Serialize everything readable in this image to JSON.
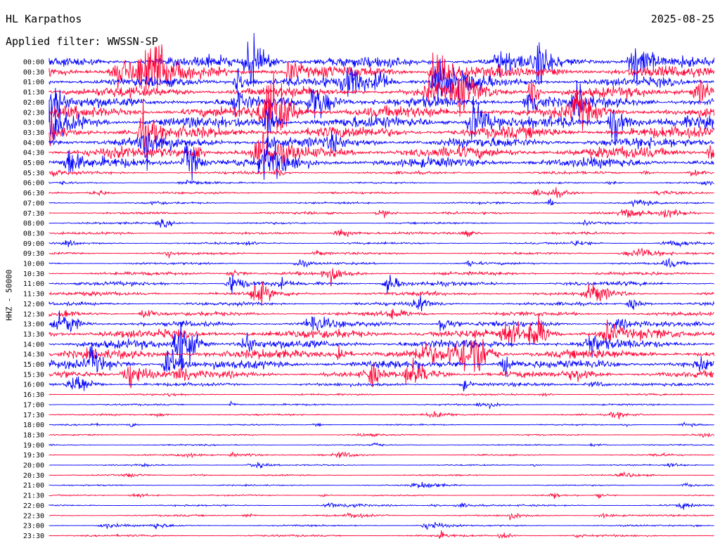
{
  "header": {
    "station": "HL Karpathos",
    "date": "2025-08-25",
    "filter": "Applied filter: WWSSN-SP"
  },
  "colors": {
    "blue": "#0000ff",
    "red": "#ff0033",
    "text": "#000000",
    "background": "#ffffff"
  },
  "chart_data": {
    "type": "line",
    "title": "HL Karpathos",
    "date": "2025-08-25",
    "ylabel": "HHZ - 50000",
    "row_labels": [
      "00:00",
      "00:30",
      "01:00",
      "01:30",
      "02:00",
      "02:30",
      "03:00",
      "03:30",
      "04:00",
      "04:30",
      "05:00",
      "05:30",
      "06:00",
      "06:30",
      "07:00",
      "07:30",
      "08:00",
      "08:30",
      "09:00",
      "09:30",
      "10:00",
      "10:30",
      "11:00",
      "11:30",
      "12:00",
      "12:30",
      "13:00",
      "13:30",
      "14:00",
      "14:30",
      "15:00",
      "15:30",
      "16:00",
      "16:30",
      "17:00",
      "17:30",
      "18:00",
      "18:30",
      "19:00",
      "19:30",
      "20:00",
      "20:30",
      "21:00",
      "21:30",
      "22:00",
      "22:30",
      "23:00",
      "23:30"
    ],
    "series_colors": [
      "#0000ff",
      "#ff0033"
    ],
    "noise_level": [
      1.6,
      1.8,
      1.4,
      1.6,
      1.6,
      1.8,
      1.8,
      1.8,
      1.6,
      1.8,
      1.5,
      0.4,
      0.25,
      0.3,
      0.3,
      0.35,
      0.3,
      0.35,
      0.3,
      0.35,
      0.35,
      0.5,
      0.6,
      0.6,
      0.5,
      0.6,
      0.8,
      1.4,
      1.3,
      1.4,
      1.3,
      1.0,
      0.5,
      0.25,
      0.25,
      0.25,
      0.2,
      0.2,
      0.2,
      0.2,
      0.2,
      0.2,
      0.2,
      0.2,
      0.25,
      0.25,
      0.25,
      0.3
    ]
  }
}
